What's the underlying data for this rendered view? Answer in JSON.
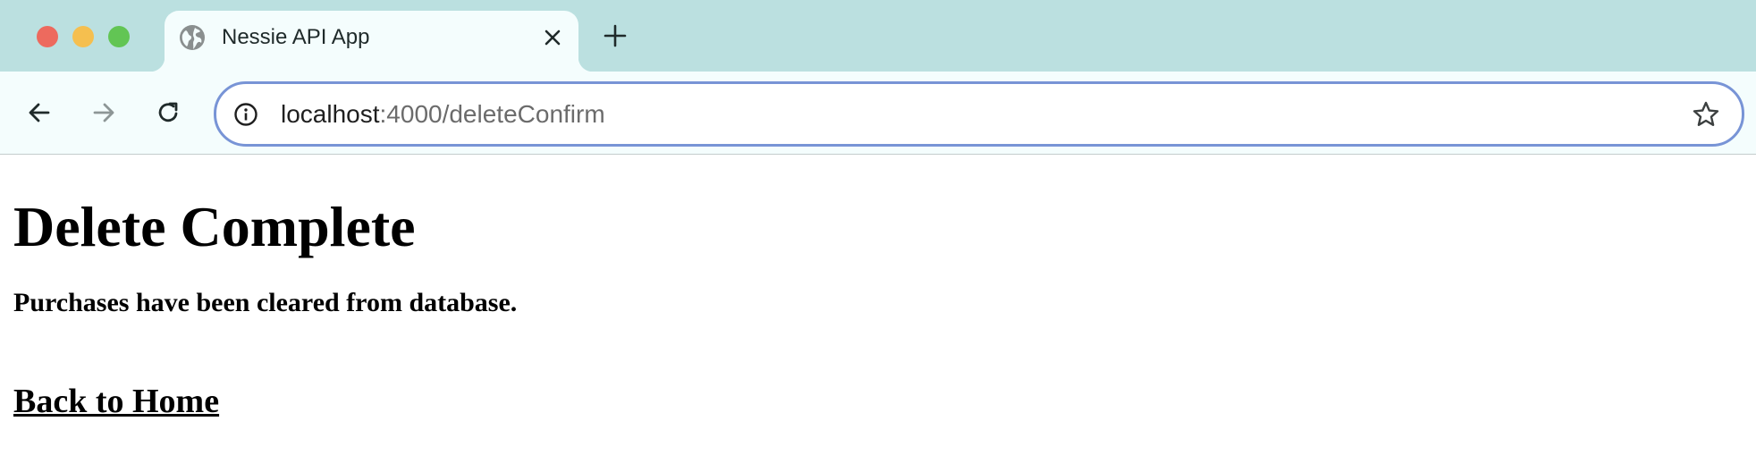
{
  "browser": {
    "tab": {
      "title": "Nessie API App",
      "favicon": "globe-icon"
    },
    "address_bar": {
      "url_host": "localhost",
      "url_rest": ":4000/deleteConfirm"
    },
    "icons": {
      "back": "arrow-left-icon",
      "forward": "arrow-right-icon",
      "reload": "reload-icon",
      "site_info": "info-icon",
      "bookmark": "star-icon",
      "close_tab": "close-icon",
      "new_tab": "plus-icon"
    },
    "colors": {
      "tab_strip": "#bbe0e0",
      "toolbar": "#f4fdfd",
      "omnibox_border": "#7894d6",
      "traffic_close": "#ed6a5e",
      "traffic_minimize": "#f5bf4f",
      "traffic_maximize": "#62c554"
    }
  },
  "page": {
    "heading": "Delete Complete",
    "message": "Purchases have been cleared from database.",
    "back_link": "Back to Home"
  }
}
